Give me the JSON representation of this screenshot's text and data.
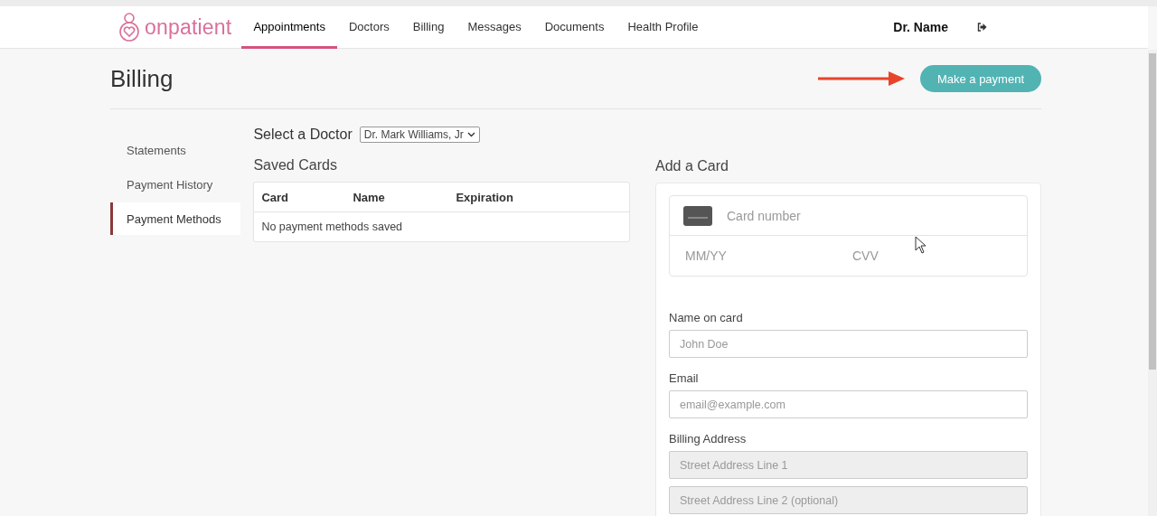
{
  "brand": {
    "name": "onpatient"
  },
  "nav": [
    {
      "label": "Appointments",
      "selected": true
    },
    {
      "label": "Doctors",
      "selected": false
    },
    {
      "label": "Billing",
      "selected": false
    },
    {
      "label": "Messages",
      "selected": false
    },
    {
      "label": "Documents",
      "selected": false
    },
    {
      "label": "Health Profile",
      "selected": false
    }
  ],
  "user": {
    "name": "Dr. Name"
  },
  "page": {
    "title": "Billing",
    "action": "Make a payment"
  },
  "sidebar": {
    "items": [
      {
        "label": "Statements",
        "selected": false
      },
      {
        "label": "Payment History",
        "selected": false
      },
      {
        "label": "Payment Methods",
        "selected": true
      }
    ]
  },
  "doctor_select": {
    "label": "Select a Doctor",
    "value": "Dr. Mark Williams, Jr"
  },
  "saved_cards": {
    "title": "Saved Cards",
    "columns": [
      "Card",
      "Name",
      "Expiration"
    ],
    "empty_message": "No payment methods saved"
  },
  "add_card": {
    "title": "Add a Card",
    "card_number": {
      "placeholder": "Card number"
    },
    "expiry": {
      "placeholder": "MM/YY"
    },
    "cvv": {
      "placeholder": "CVV"
    },
    "fields": [
      {
        "label": "Name on card",
        "placeholder": "John Doe"
      },
      {
        "label": "Email",
        "placeholder": "email@example.com"
      }
    ],
    "billing_address": {
      "label": "Billing Address",
      "lines": [
        {
          "placeholder": "Street Address Line 1"
        },
        {
          "placeholder": "Street Address Line 2 (optional)"
        }
      ]
    }
  }
}
